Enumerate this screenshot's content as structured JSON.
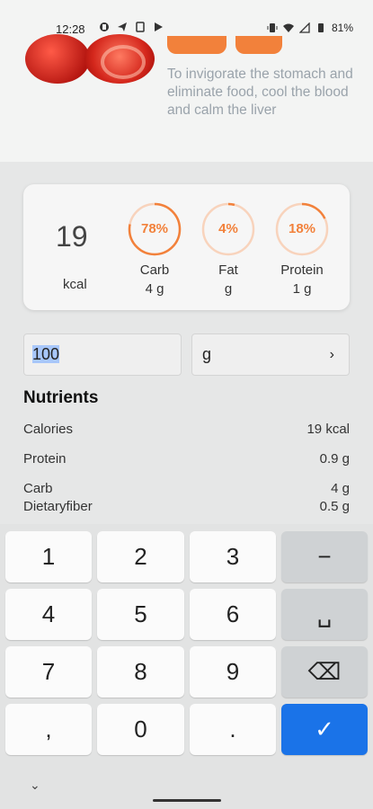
{
  "status_bar": {
    "time": "12:28",
    "battery": "81%",
    "icons": [
      "app-icon",
      "send-icon",
      "card-icon",
      "play-icon",
      "vibrate-icon",
      "wifi-icon",
      "signal-icon",
      "battery-icon"
    ]
  },
  "food": {
    "description": "To invigorate the stomach and eliminate food, cool the blood and calm the liver",
    "accent_color": "#f2813b"
  },
  "summary": {
    "kcal_value": "19",
    "kcal_unit": "kcal",
    "macros": [
      {
        "percent": "78%",
        "fraction": 0.78,
        "label": "Carb",
        "amount": "4 g"
      },
      {
        "percent": "4%",
        "fraction": 0.04,
        "label": "Fat",
        "amount": "g"
      },
      {
        "percent": "18%",
        "fraction": 0.18,
        "label": "Protein",
        "amount": "1 g"
      }
    ]
  },
  "portion": {
    "amount": "100",
    "unit": "g",
    "chevron": "›"
  },
  "nutrients": {
    "title": "Nutrients",
    "rows": [
      {
        "name": "Calories",
        "value": "19 kcal"
      },
      {
        "name": "Protein",
        "value": "0.9 g"
      },
      {
        "name": "Carb",
        "value": "4 g"
      },
      {
        "name": "Dietaryfiber",
        "value": "0.5 g"
      }
    ]
  },
  "keyboard": {
    "keys": [
      "1",
      "2",
      "3",
      "−",
      "4",
      "5",
      "6",
      "␣",
      "7",
      "8",
      "9",
      "⌫",
      ",",
      "0",
      ".",
      "✓"
    ],
    "hide": "⌄"
  }
}
